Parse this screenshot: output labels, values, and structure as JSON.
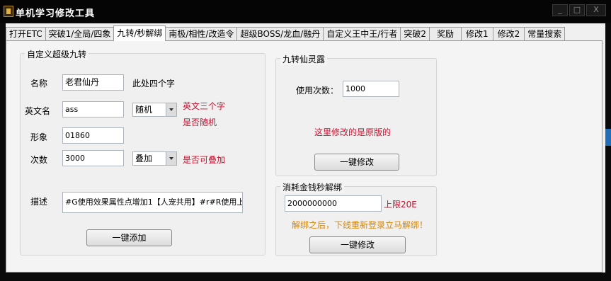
{
  "window": {
    "title": "单机学习修改工具",
    "min": "_",
    "max": "□",
    "close": "X"
  },
  "tabs": [
    {
      "label": "打开ETC"
    },
    {
      "label": "突破1/全局/四象"
    },
    {
      "label": "九转/秒解绑",
      "active": true
    },
    {
      "label": "南极/相性/改造令"
    },
    {
      "label": "超级BOSS/龙血/融丹"
    },
    {
      "label": "自定义王中王/行者"
    },
    {
      "label": "突破2"
    },
    {
      "label": "奖励"
    },
    {
      "label": "修改1"
    },
    {
      "label": "修改2"
    },
    {
      "label": "常量搜索"
    }
  ],
  "custom_jiuzhuan": {
    "legend": "自定义超级九转",
    "name_label": "名称",
    "name_value": "老君仙丹",
    "name_hint": "此处四个字",
    "en_label": "英文名",
    "en_value": "ass",
    "en_combo": "随机",
    "en_hint_1": "英文三个字",
    "en_hint_2": "是否随机",
    "image_label": "形象",
    "image_value": "01860",
    "count_label": "次数",
    "count_value": "3000",
    "count_combo": "叠加",
    "count_hint": "是否可叠加",
    "desc_label": "描述",
    "desc_value": "#G使用效果属性点增加1【人宠共用】#r#R使用上",
    "add_button": "一键添加"
  },
  "jiuzhuan_lingl": {
    "legend": "九转仙灵露",
    "uses_label": "使用次数：",
    "uses_value": "1000",
    "note": "这里修改的是原版的",
    "modify_button": "一键修改"
  },
  "money_unbind": {
    "legend": "消耗金钱秒解绑",
    "money_value": "2000000000",
    "limit": "上限20E",
    "note": "解绑之后，下线重新登录立马解绑！",
    "modify_button": "一键修改"
  },
  "colors": {
    "accent_red": "#c8102e",
    "accent_orange": "#d4860b"
  }
}
